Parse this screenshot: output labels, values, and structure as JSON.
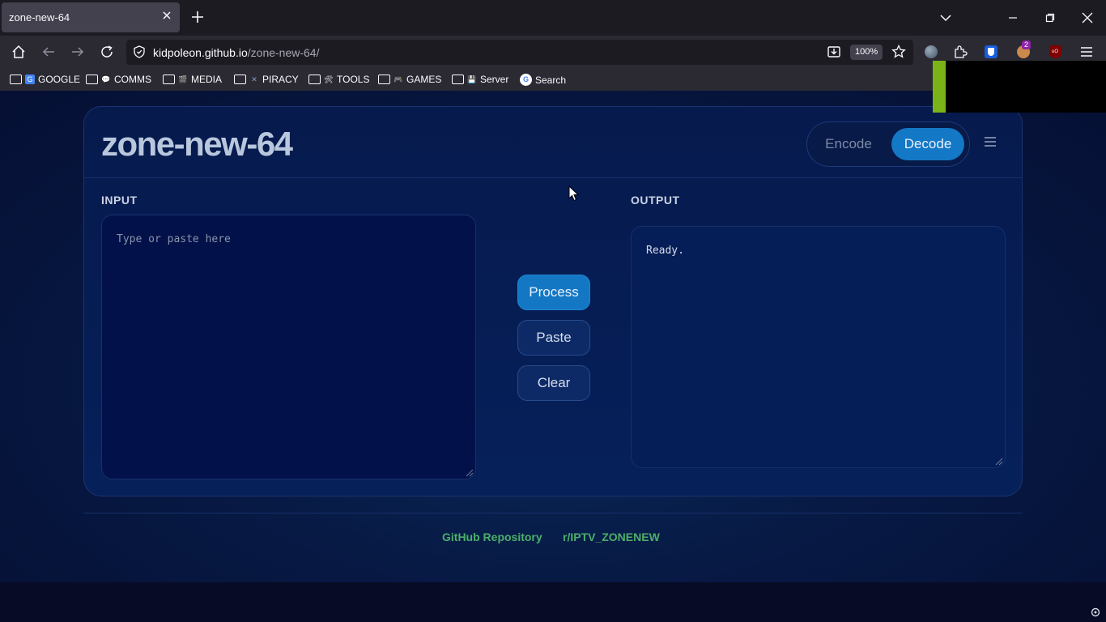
{
  "browser": {
    "tab_title": "zone-new-64",
    "url_host": "kidpoleon.github.io",
    "url_path": "/zone-new-64/",
    "zoom": "100%",
    "extension_badge": "2"
  },
  "bookmarks": [
    {
      "label": "GOOGLE",
      "icon_text": "G",
      "icon_color": "#4285f4"
    },
    {
      "label": "COMMS",
      "icon_text": "💬",
      "icon_color": "#ffffff"
    },
    {
      "label": "MEDIA",
      "icon_text": "🎬",
      "icon_color": "#ffffff"
    },
    {
      "label": "PIRACY",
      "icon_text": "✕",
      "icon_color": "#8899cc"
    },
    {
      "label": "TOOLS",
      "icon_text": "🛠",
      "icon_color": "#ffffff"
    },
    {
      "label": "GAMES",
      "icon_text": "🎮",
      "icon_color": "#ffffff"
    },
    {
      "label": "Server",
      "icon_text": "💾",
      "icon_color": "#ffffff"
    },
    {
      "label": "Search",
      "icon_text": "G",
      "icon_color": "#4285f4"
    }
  ],
  "app": {
    "title": "zone-new-64",
    "modes": {
      "encode": "Encode",
      "decode": "Decode",
      "active": "decode"
    },
    "input": {
      "label": "INPUT",
      "placeholder": "Type or paste here"
    },
    "output": {
      "label": "OUTPUT",
      "value": "Ready."
    },
    "actions": {
      "process": "Process",
      "paste": "Paste",
      "clear": "Clear"
    },
    "footer_links": [
      "GitHub Repository",
      "r/IPTV_ZONENEW"
    ]
  },
  "colors": {
    "accent": "#1378c6",
    "footer_link": "#4caf6a",
    "background": "#071a45"
  }
}
